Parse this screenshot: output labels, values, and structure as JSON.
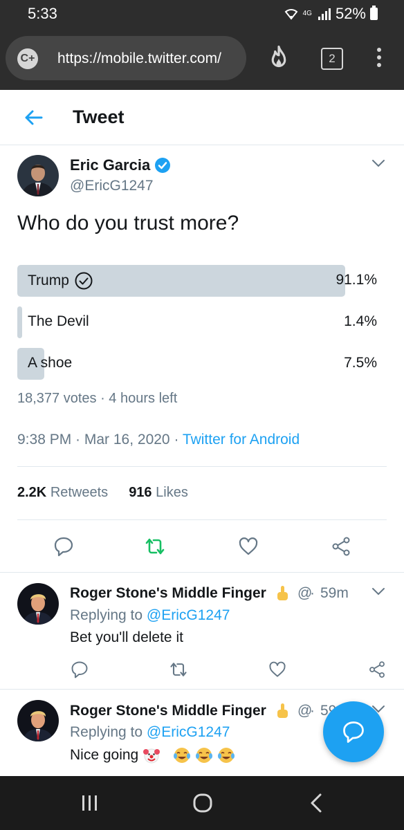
{
  "status_bar": {
    "time": "5:33",
    "network": "4G",
    "battery": "52%"
  },
  "browser": {
    "url": "https://mobile.twitter.com/",
    "tab_count": "2",
    "icons": [
      "c-plus-icon",
      "flame-icon",
      "tabs-icon",
      "kebab-menu-icon"
    ]
  },
  "header": {
    "title": "Tweet"
  },
  "tweet": {
    "author_name": "Eric Garcia",
    "author_handle": "@EricG1247",
    "text": "Who do you trust more?",
    "poll": {
      "options": [
        {
          "label": "Trump",
          "percent": "91.1%",
          "value": 91.1,
          "winner": true
        },
        {
          "label": "The Devil",
          "percent": "1.4%",
          "value": 1.4,
          "winner": false
        },
        {
          "label": "A shoe",
          "percent": "7.5%",
          "value": 7.5,
          "winner": false
        }
      ],
      "meta": "18,377 votes · 4 hours left"
    },
    "time": "9:38 PM · Mar 16, 2020 · ",
    "source": "Twitter for Android",
    "retweets_count": "2.2K",
    "retweets_label": "Retweets",
    "likes_count": "916",
    "likes_label": "Likes"
  },
  "replies": [
    {
      "author_name": "Roger Stone's Middle Finger",
      "handle_fragment": "@",
      "separator": "·",
      "time": "59m",
      "replying_prefix": "Replying to ",
      "replying_to": "@EricG1247",
      "text": "Bet you'll delete it",
      "emojis": []
    },
    {
      "author_name": "Roger Stone's Middle Finger",
      "handle_fragment": "@",
      "separator": "·",
      "time": "59",
      "replying_prefix": "Replying to ",
      "replying_to": "@EricG1247",
      "text": "Nice going",
      "emojis": [
        "clown-face",
        "tears-of-joy",
        "tears-of-joy",
        "tears-of-joy"
      ]
    }
  ],
  "colors": {
    "accent": "#1da1f2",
    "retweet_active": "#17bf63",
    "poll_bar": "#ccd6dd",
    "muted": "#657786",
    "browser_bar": "#2d2d2d"
  }
}
